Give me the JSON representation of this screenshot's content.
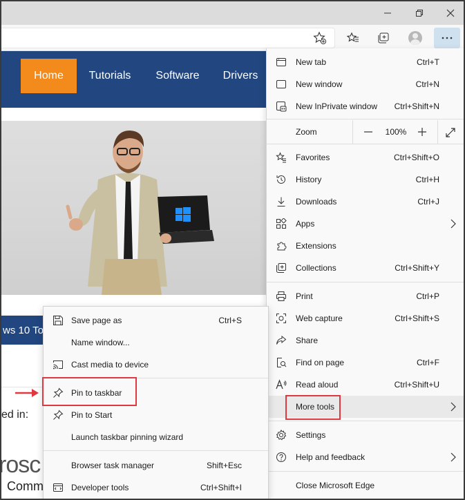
{
  "accent_colors": {
    "site_nav": "#214680",
    "home_tab": "#f28a1c",
    "annotation_red": "#e0383e",
    "more_button_bg": "#cfe0ef"
  },
  "window_controls": {
    "minimize_icon": "minimize-icon",
    "maximize_icon": "restore-icon",
    "close_icon": "close-icon"
  },
  "toolbar": {
    "icons": [
      "add-favorite-icon",
      "favorites-icon",
      "collections-icon",
      "profile-avatar",
      "more-icon"
    ]
  },
  "website": {
    "nav": [
      "Home",
      "Tutorials",
      "Software",
      "Drivers"
    ],
    "article_snippet": "ws 10 To",
    "featured_label": "ed in:",
    "logo_fragment": "rosc",
    "logo_subtext": "Comm"
  },
  "main_menu": {
    "items": [
      {
        "label": "New tab",
        "shortcut": "Ctrl+T",
        "icon": "new-tab-icon"
      },
      {
        "label": "New window",
        "shortcut": "Ctrl+N",
        "icon": "new-window-icon"
      },
      {
        "label": "New InPrivate window",
        "shortcut": "Ctrl+Shift+N",
        "icon": "inprivate-icon"
      },
      {
        "label": "Favorites",
        "shortcut": "Ctrl+Shift+O",
        "icon": "favorites-icon"
      },
      {
        "label": "History",
        "shortcut": "Ctrl+H",
        "icon": "history-icon"
      },
      {
        "label": "Downloads",
        "shortcut": "Ctrl+J",
        "icon": "download-icon"
      },
      {
        "label": "Apps",
        "shortcut": "",
        "icon": "apps-icon"
      },
      {
        "label": "Extensions",
        "shortcut": "",
        "icon": "extensions-icon"
      },
      {
        "label": "Collections",
        "shortcut": "Ctrl+Shift+Y",
        "icon": "collections-icon"
      },
      {
        "label": "Print",
        "shortcut": "Ctrl+P",
        "icon": "print-icon"
      },
      {
        "label": "Web capture",
        "shortcut": "Ctrl+Shift+S",
        "icon": "web-capture-icon"
      },
      {
        "label": "Share",
        "shortcut": "",
        "icon": "share-icon"
      },
      {
        "label": "Find on page",
        "shortcut": "Ctrl+F",
        "icon": "find-icon"
      },
      {
        "label": "Read aloud",
        "shortcut": "Ctrl+Shift+U",
        "icon": "read-aloud-icon"
      },
      {
        "label": "More tools",
        "shortcut": "",
        "icon": ""
      },
      {
        "label": "Settings",
        "shortcut": "",
        "icon": "settings-icon"
      },
      {
        "label": "Help and feedback",
        "shortcut": "",
        "icon": "help-icon"
      },
      {
        "label": "Close Microsoft Edge",
        "shortcut": "",
        "icon": ""
      }
    ],
    "zoom": {
      "label": "Zoom",
      "value": "100%"
    }
  },
  "more_tools_menu": {
    "items": [
      {
        "label": "Save page as",
        "shortcut": "Ctrl+S",
        "icon": "save-icon"
      },
      {
        "label": "Name window...",
        "shortcut": "",
        "icon": ""
      },
      {
        "label": "Cast media to device",
        "shortcut": "",
        "icon": "cast-icon"
      },
      {
        "label": "Pin to taskbar",
        "shortcut": "",
        "icon": "pin-icon"
      },
      {
        "label": "Pin to Start",
        "shortcut": "",
        "icon": "pin-icon"
      },
      {
        "label": "Launch taskbar pinning wizard",
        "shortcut": "",
        "icon": ""
      },
      {
        "label": "Browser task manager",
        "shortcut": "Shift+Esc",
        "icon": ""
      },
      {
        "label": "Developer tools",
        "shortcut": "Ctrl+Shift+I",
        "icon": "developer-tools-icon"
      }
    ]
  }
}
